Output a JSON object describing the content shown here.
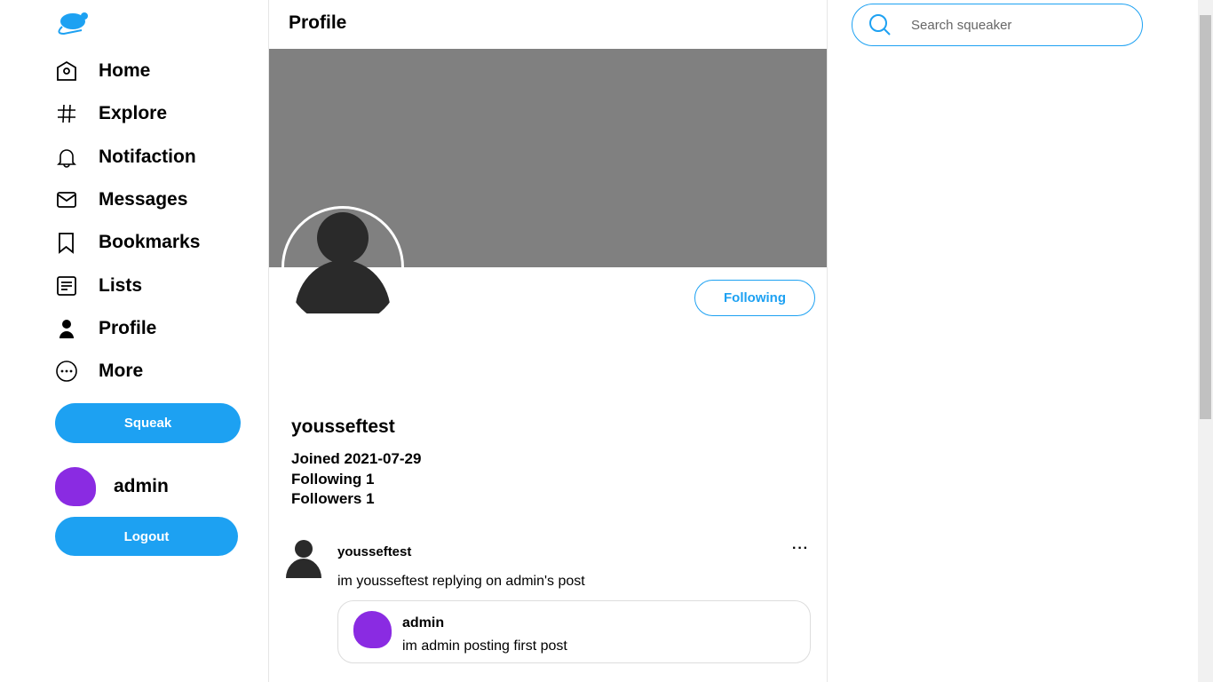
{
  "colors": {
    "accent": "#1da1f2",
    "avatar": "#8a2be2",
    "banner": "#808080"
  },
  "nav": [
    {
      "label": "Home",
      "icon": "home-icon"
    },
    {
      "label": "Explore",
      "icon": "hashtag-icon"
    },
    {
      "label": "Notifaction",
      "icon": "bell-icon"
    },
    {
      "label": "Messages",
      "icon": "mail-icon"
    },
    {
      "label": "Bookmarks",
      "icon": "bookmark-icon"
    },
    {
      "label": "Lists",
      "icon": "list-icon"
    },
    {
      "label": "Profile",
      "icon": "person-icon"
    },
    {
      "label": "More",
      "icon": "more-icon"
    }
  ],
  "squeak_label": "Squeak",
  "current_user": "admin",
  "logout_label": "Logout",
  "header": {
    "title": "Profile"
  },
  "profile": {
    "follow_label": "Following",
    "name": "yousseftest",
    "joined": "Joined 2021-07-29",
    "following": "Following 1",
    "followers": "Followers 1"
  },
  "post": {
    "author": "yousseftest",
    "text": "im yousseftest replying on admin's post",
    "quote": {
      "author": "admin",
      "text": "im admin posting first post"
    }
  },
  "search": {
    "placeholder": "Search squeaker"
  }
}
